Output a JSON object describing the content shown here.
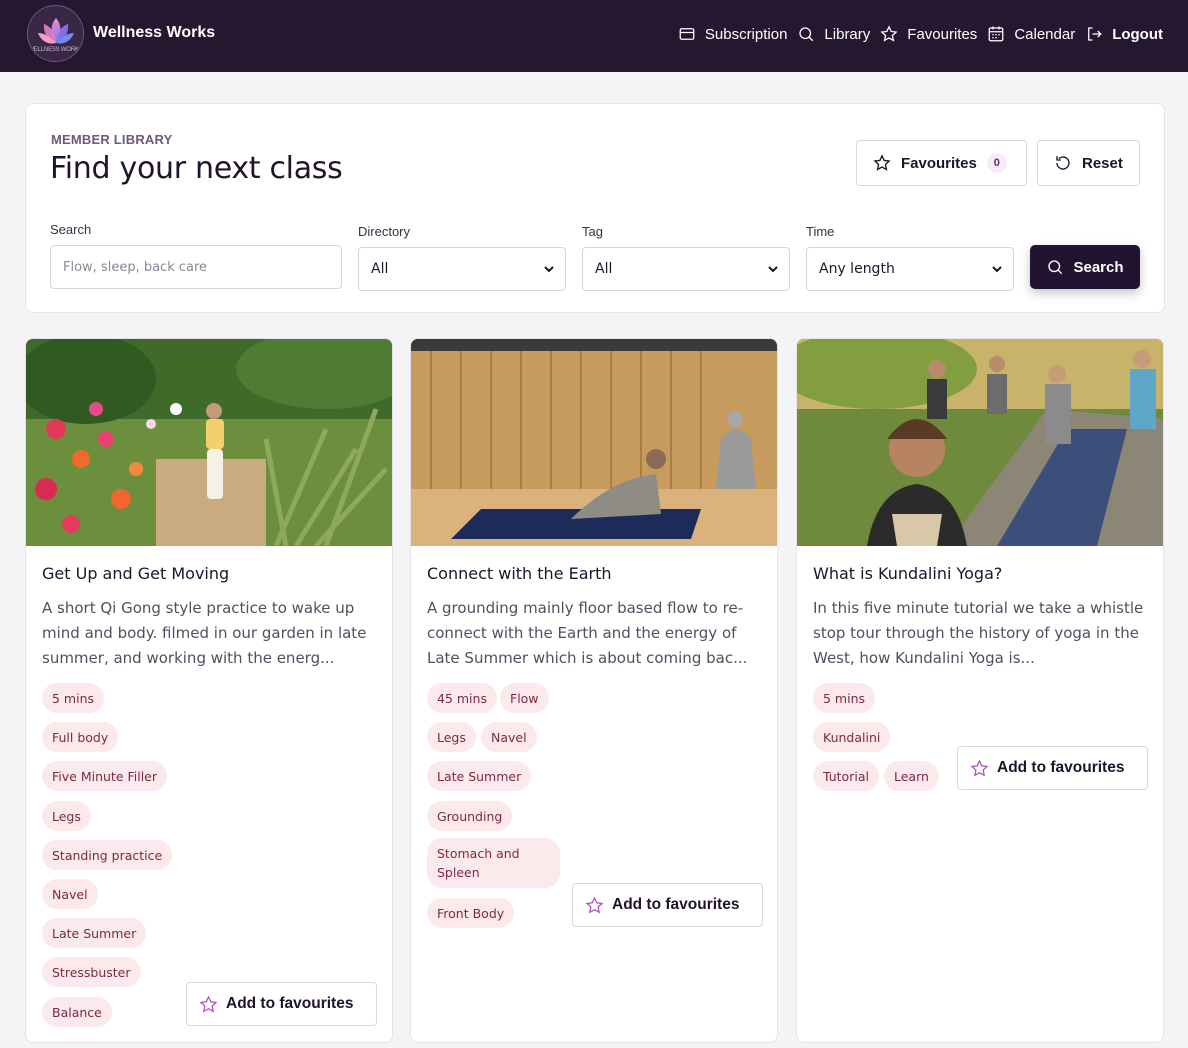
{
  "nav": {
    "brand": "Wellness Works",
    "logo_subtext": "WELLNESS WORKS",
    "links": [
      {
        "label": "Subscription",
        "icon": "credit-card-icon"
      },
      {
        "label": "Library",
        "icon": "search-icon"
      },
      {
        "label": "Favourites",
        "icon": "star-icon"
      },
      {
        "label": "Calendar",
        "icon": "calendar-icon"
      },
      {
        "label": "Logout",
        "icon": "logout-icon"
      }
    ]
  },
  "panel": {
    "eyebrow": "MEMBER LIBRARY",
    "title": "Find your next class",
    "favourites_label": "Favourites",
    "favourites_count": "0",
    "reset_label": "Reset",
    "search_label": "Search",
    "search_placeholder": "Flow, sleep, back care",
    "directory_label": "Directory",
    "directory_value": "All",
    "tag_label": "Tag",
    "tag_value": "All",
    "time_label": "Time",
    "time_value": "Any length",
    "search_button": "Search"
  },
  "cards": [
    {
      "title": "Get Up and Get Moving",
      "description": "A short Qi Gong style practice to wake up mind and body. filmed in our garden in late summer, and working with the energ...",
      "tags": [
        "5 mins",
        "Full body",
        "Five Minute Filler",
        "Legs",
        "Standing practice",
        "Navel",
        "Late Summer",
        "Stressbuster",
        "Balance"
      ],
      "add_label": "Add to favourites"
    },
    {
      "title": "Connect with the Earth",
      "description": "A grounding mainly floor based flow to re-connect with the Earth and the energy of Late Summer which is about coming bac...",
      "tags": [
        "45 mins",
        "Flow",
        "Legs",
        "Navel",
        "Late Summer",
        "Grounding",
        "Stomach and Spleen",
        "Front Body"
      ],
      "add_label": "Add to favourites"
    },
    {
      "title": "What is Kundalini Yoga?",
      "description": "In this five minute tutorial we take a whistle stop tour through the history of yoga in the West, how Kundalini Yoga is...",
      "tags": [
        "5 mins",
        "Kundalini",
        "Tutorial",
        "Learn"
      ],
      "add_label": "Add to favourites"
    }
  ],
  "colors": {
    "nav_bg": "#261730",
    "accent": "#221431",
    "tag_bg": "#fbe9ec",
    "tag_text": "#7a2a48",
    "star_accent": "#b04fc1"
  }
}
